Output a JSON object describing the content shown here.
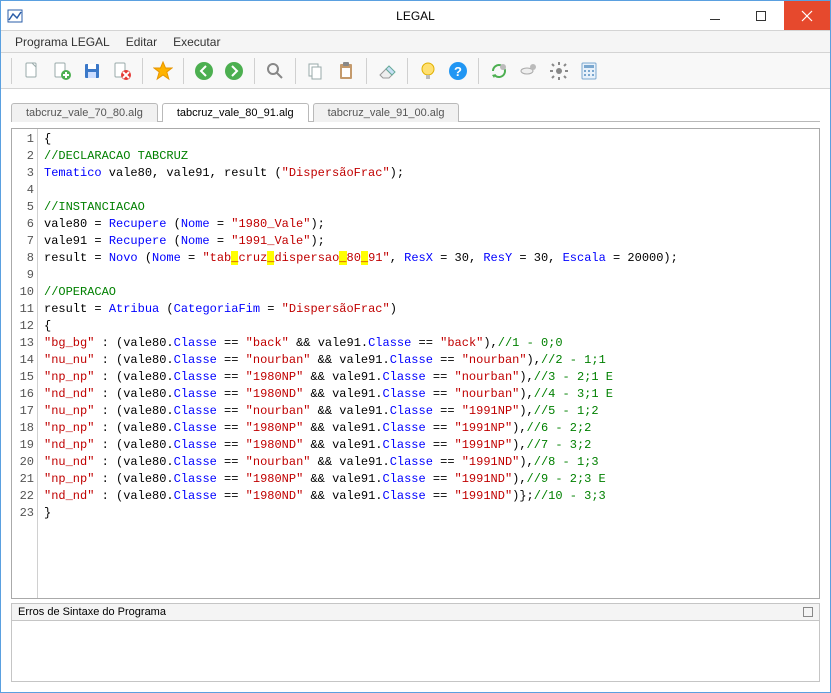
{
  "window": {
    "title": "LEGAL"
  },
  "menu": {
    "items": [
      "Programa LEGAL",
      "Editar",
      "Executar"
    ]
  },
  "tabs": {
    "items": [
      {
        "label": "tabcruz_vale_70_80.alg",
        "active": false
      },
      {
        "label": "tabcruz_vale_80_91.alg",
        "active": true
      },
      {
        "label": "tabcruz_vale_91_00.alg",
        "active": false
      }
    ]
  },
  "error_panel": {
    "title": "Erros de Sintaxe do Programa"
  },
  "code": {
    "line_count": 23,
    "lines": [
      {
        "n": 1,
        "tokens": [
          {
            "t": "{",
            "c": "plain"
          }
        ]
      },
      {
        "n": 2,
        "tokens": [
          {
            "t": "//DECLARACAO TABCRUZ",
            "c": "cmt"
          }
        ]
      },
      {
        "n": 3,
        "tokens": [
          {
            "t": "Tematico",
            "c": "kw"
          },
          {
            "t": " vale80, vale91, result (",
            "c": "plain"
          },
          {
            "t": "\"DispersãoFrac\"",
            "c": "str"
          },
          {
            "t": ");",
            "c": "plain"
          }
        ]
      },
      {
        "n": 4,
        "tokens": []
      },
      {
        "n": 5,
        "tokens": [
          {
            "t": "//INSTANCIACAO",
            "c": "cmt"
          }
        ]
      },
      {
        "n": 6,
        "tokens": [
          {
            "t": "vale80 = ",
            "c": "plain"
          },
          {
            "t": "Recupere",
            "c": "kw"
          },
          {
            "t": " (",
            "c": "plain"
          },
          {
            "t": "Nome",
            "c": "kw"
          },
          {
            "t": " = ",
            "c": "plain"
          },
          {
            "t": "\"1980_Vale\"",
            "c": "str"
          },
          {
            "t": ");",
            "c": "plain"
          }
        ]
      },
      {
        "n": 7,
        "tokens": [
          {
            "t": "vale91 = ",
            "c": "plain"
          },
          {
            "t": "Recupere",
            "c": "kw"
          },
          {
            "t": " (",
            "c": "plain"
          },
          {
            "t": "Nome",
            "c": "kw"
          },
          {
            "t": " = ",
            "c": "plain"
          },
          {
            "t": "\"1991_Vale\"",
            "c": "str"
          },
          {
            "t": ");",
            "c": "plain"
          }
        ]
      },
      {
        "n": 8,
        "tokens": [
          {
            "t": "result = ",
            "c": "plain"
          },
          {
            "t": "Novo",
            "c": "kw"
          },
          {
            "t": " (",
            "c": "plain"
          },
          {
            "t": "Nome",
            "c": "kw"
          },
          {
            "t": " = ",
            "c": "plain"
          },
          {
            "t": "\"tab",
            "c": "str"
          },
          {
            "t": "_",
            "c": "str hl"
          },
          {
            "t": "cruz",
            "c": "str"
          },
          {
            "t": "_",
            "c": "str hl"
          },
          {
            "t": "dispersao",
            "c": "str"
          },
          {
            "t": "_",
            "c": "str hl"
          },
          {
            "t": "80",
            "c": "str"
          },
          {
            "t": "_",
            "c": "str hl"
          },
          {
            "t": "91\"",
            "c": "str"
          },
          {
            "t": ", ",
            "c": "plain"
          },
          {
            "t": "ResX",
            "c": "kw"
          },
          {
            "t": " = 30, ",
            "c": "plain"
          },
          {
            "t": "ResY",
            "c": "kw"
          },
          {
            "t": " = 30, ",
            "c": "plain"
          },
          {
            "t": "Escala",
            "c": "kw"
          },
          {
            "t": " = 20000);",
            "c": "plain"
          }
        ]
      },
      {
        "n": 9,
        "tokens": []
      },
      {
        "n": 10,
        "tokens": [
          {
            "t": "//OPERACAO",
            "c": "cmt"
          }
        ]
      },
      {
        "n": 11,
        "tokens": [
          {
            "t": "result = ",
            "c": "plain"
          },
          {
            "t": "Atribua",
            "c": "kw"
          },
          {
            "t": " (",
            "c": "plain"
          },
          {
            "t": "CategoriaFim",
            "c": "kw"
          },
          {
            "t": " = ",
            "c": "plain"
          },
          {
            "t": "\"DispersãoFrac\"",
            "c": "str"
          },
          {
            "t": ")",
            "c": "plain"
          }
        ]
      },
      {
        "n": 12,
        "tokens": [
          {
            "t": "{",
            "c": "plain"
          }
        ]
      },
      {
        "n": 13,
        "tokens": [
          {
            "t": "\"bg_bg\"",
            "c": "str"
          },
          {
            "t": " : (vale80.",
            "c": "plain"
          },
          {
            "t": "Classe",
            "c": "kw"
          },
          {
            "t": " == ",
            "c": "plain"
          },
          {
            "t": "\"back\"",
            "c": "str"
          },
          {
            "t": " && vale91.",
            "c": "plain"
          },
          {
            "t": "Classe",
            "c": "kw"
          },
          {
            "t": " == ",
            "c": "plain"
          },
          {
            "t": "\"back\"",
            "c": "str"
          },
          {
            "t": "),",
            "c": "plain"
          },
          {
            "t": "//1 - 0;0",
            "c": "cmt"
          }
        ]
      },
      {
        "n": 14,
        "tokens": [
          {
            "t": "\"nu_nu\"",
            "c": "str"
          },
          {
            "t": " : (vale80.",
            "c": "plain"
          },
          {
            "t": "Classe",
            "c": "kw"
          },
          {
            "t": " == ",
            "c": "plain"
          },
          {
            "t": "\"nourban\"",
            "c": "str"
          },
          {
            "t": " && vale91.",
            "c": "plain"
          },
          {
            "t": "Classe",
            "c": "kw"
          },
          {
            "t": " == ",
            "c": "plain"
          },
          {
            "t": "\"nourban\"",
            "c": "str"
          },
          {
            "t": "),",
            "c": "plain"
          },
          {
            "t": "//2 - 1;1",
            "c": "cmt"
          }
        ]
      },
      {
        "n": 15,
        "tokens": [
          {
            "t": "\"np_np\"",
            "c": "str"
          },
          {
            "t": " : (vale80.",
            "c": "plain"
          },
          {
            "t": "Classe",
            "c": "kw"
          },
          {
            "t": " == ",
            "c": "plain"
          },
          {
            "t": "\"1980NP\"",
            "c": "str"
          },
          {
            "t": " && vale91.",
            "c": "plain"
          },
          {
            "t": "Classe",
            "c": "kw"
          },
          {
            "t": " == ",
            "c": "plain"
          },
          {
            "t": "\"nourban\"",
            "c": "str"
          },
          {
            "t": "),",
            "c": "plain"
          },
          {
            "t": "//3 - 2;1 E",
            "c": "cmt"
          }
        ]
      },
      {
        "n": 16,
        "tokens": [
          {
            "t": "\"nd_nd\"",
            "c": "str"
          },
          {
            "t": " : (vale80.",
            "c": "plain"
          },
          {
            "t": "Classe",
            "c": "kw"
          },
          {
            "t": " == ",
            "c": "plain"
          },
          {
            "t": "\"1980ND\"",
            "c": "str"
          },
          {
            "t": " && vale91.",
            "c": "plain"
          },
          {
            "t": "Classe",
            "c": "kw"
          },
          {
            "t": " == ",
            "c": "plain"
          },
          {
            "t": "\"nourban\"",
            "c": "str"
          },
          {
            "t": "),",
            "c": "plain"
          },
          {
            "t": "//4 - 3;1 E",
            "c": "cmt"
          }
        ]
      },
      {
        "n": 17,
        "tokens": [
          {
            "t": "\"nu_np\"",
            "c": "str"
          },
          {
            "t": " : (vale80.",
            "c": "plain"
          },
          {
            "t": "Classe",
            "c": "kw"
          },
          {
            "t": " == ",
            "c": "plain"
          },
          {
            "t": "\"nourban\"",
            "c": "str"
          },
          {
            "t": " && vale91.",
            "c": "plain"
          },
          {
            "t": "Classe",
            "c": "kw"
          },
          {
            "t": " == ",
            "c": "plain"
          },
          {
            "t": "\"1991NP\"",
            "c": "str"
          },
          {
            "t": "),",
            "c": "plain"
          },
          {
            "t": "//5 - 1;2",
            "c": "cmt"
          }
        ]
      },
      {
        "n": 18,
        "tokens": [
          {
            "t": "\"np_np\"",
            "c": "str"
          },
          {
            "t": " : (vale80.",
            "c": "plain"
          },
          {
            "t": "Classe",
            "c": "kw"
          },
          {
            "t": " == ",
            "c": "plain"
          },
          {
            "t": "\"1980NP\"",
            "c": "str"
          },
          {
            "t": " && vale91.",
            "c": "plain"
          },
          {
            "t": "Classe",
            "c": "kw"
          },
          {
            "t": " == ",
            "c": "plain"
          },
          {
            "t": "\"1991NP\"",
            "c": "str"
          },
          {
            "t": "),",
            "c": "plain"
          },
          {
            "t": "//6 - 2;2",
            "c": "cmt"
          }
        ]
      },
      {
        "n": 19,
        "tokens": [
          {
            "t": "\"nd_np\"",
            "c": "str"
          },
          {
            "t": " : (vale80.",
            "c": "plain"
          },
          {
            "t": "Classe",
            "c": "kw"
          },
          {
            "t": " == ",
            "c": "plain"
          },
          {
            "t": "\"1980ND\"",
            "c": "str"
          },
          {
            "t": " && vale91.",
            "c": "plain"
          },
          {
            "t": "Classe",
            "c": "kw"
          },
          {
            "t": " == ",
            "c": "plain"
          },
          {
            "t": "\"1991NP\"",
            "c": "str"
          },
          {
            "t": "),",
            "c": "plain"
          },
          {
            "t": "//7 - 3;2",
            "c": "cmt"
          }
        ]
      },
      {
        "n": 20,
        "tokens": [
          {
            "t": "\"nu_nd\"",
            "c": "str"
          },
          {
            "t": " : (vale80.",
            "c": "plain"
          },
          {
            "t": "Classe",
            "c": "kw"
          },
          {
            "t": " == ",
            "c": "plain"
          },
          {
            "t": "\"nourban\"",
            "c": "str"
          },
          {
            "t": " && vale91.",
            "c": "plain"
          },
          {
            "t": "Classe",
            "c": "kw"
          },
          {
            "t": " == ",
            "c": "plain"
          },
          {
            "t": "\"1991ND\"",
            "c": "str"
          },
          {
            "t": "),",
            "c": "plain"
          },
          {
            "t": "//8 - 1;3",
            "c": "cmt"
          }
        ]
      },
      {
        "n": 21,
        "tokens": [
          {
            "t": "\"np_np\"",
            "c": "str"
          },
          {
            "t": " : (vale80.",
            "c": "plain"
          },
          {
            "t": "Classe",
            "c": "kw"
          },
          {
            "t": " == ",
            "c": "plain"
          },
          {
            "t": "\"1980NP\"",
            "c": "str"
          },
          {
            "t": " && vale91.",
            "c": "plain"
          },
          {
            "t": "Classe",
            "c": "kw"
          },
          {
            "t": " == ",
            "c": "plain"
          },
          {
            "t": "\"1991ND\"",
            "c": "str"
          },
          {
            "t": "),",
            "c": "plain"
          },
          {
            "t": "//9 - 2;3 E",
            "c": "cmt"
          }
        ]
      },
      {
        "n": 22,
        "tokens": [
          {
            "t": "\"nd_nd\"",
            "c": "str"
          },
          {
            "t": " : (vale80.",
            "c": "plain"
          },
          {
            "t": "Classe",
            "c": "kw"
          },
          {
            "t": " == ",
            "c": "plain"
          },
          {
            "t": "\"1980ND\"",
            "c": "str"
          },
          {
            "t": " && vale91.",
            "c": "plain"
          },
          {
            "t": "Classe",
            "c": "kw"
          },
          {
            "t": " == ",
            "c": "plain"
          },
          {
            "t": "\"1991ND\"",
            "c": "str"
          },
          {
            "t": ")};",
            "c": "plain"
          },
          {
            "t": "//10 - 3;3",
            "c": "cmt"
          }
        ]
      },
      {
        "n": 23,
        "tokens": [
          {
            "t": "}",
            "c": "plain"
          }
        ]
      }
    ]
  }
}
